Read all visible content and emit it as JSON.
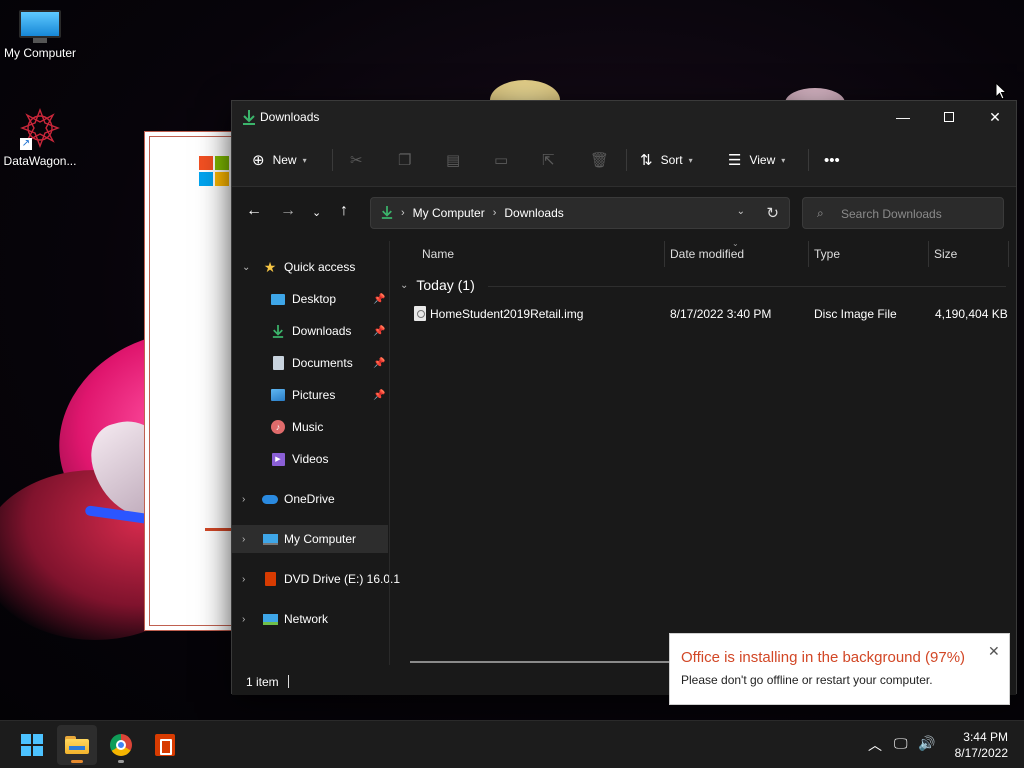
{
  "desktop": {
    "icons": [
      {
        "label": "My Computer",
        "icon": "monitor-icon"
      },
      {
        "label": "DataWagon...",
        "icon": "datawagon-logo-icon"
      }
    ]
  },
  "window": {
    "title": "Downloads",
    "icon": "download-arrow-icon"
  },
  "toolbar": {
    "new_label": "New",
    "sort_label": "Sort",
    "view_label": "View",
    "disabled_actions": [
      "cut",
      "copy",
      "paste",
      "rename",
      "share",
      "delete"
    ]
  },
  "address": {
    "breadcrumbs": [
      "My Computer",
      "Downloads"
    ]
  },
  "search": {
    "placeholder": "Search Downloads"
  },
  "nav": {
    "quick_access": "Quick access",
    "items": [
      {
        "label": "Desktop",
        "icon": "desktop-icon",
        "pinned": true
      },
      {
        "label": "Downloads",
        "icon": "download-icon",
        "pinned": true
      },
      {
        "label": "Documents",
        "icon": "document-icon",
        "pinned": true
      },
      {
        "label": "Pictures",
        "icon": "pictures-icon",
        "pinned": true
      },
      {
        "label": "Music",
        "icon": "music-icon",
        "pinned": false
      },
      {
        "label": "Videos",
        "icon": "videos-icon",
        "pinned": false
      }
    ],
    "onedrive": "OneDrive",
    "my_computer": "My Computer",
    "dvd": "DVD Drive (E:) 16.0.1",
    "network": "Network"
  },
  "columns": {
    "name": "Name",
    "date": "Date modified",
    "type": "Type",
    "size": "Size"
  },
  "group": {
    "label": "Today (1)"
  },
  "files": [
    {
      "name": "HomeStudent2019Retail.img",
      "date": "8/17/2022 3:40 PM",
      "type": "Disc Image File",
      "size": "4,190,404 KB"
    }
  ],
  "status": {
    "count": "1 item"
  },
  "notification": {
    "title": "Office is installing in the background (97%)",
    "message": "Please don't go offline or restart your computer.",
    "color": "#d24726"
  },
  "taskbar": {
    "time": "3:44 PM",
    "date": "8/17/2022"
  },
  "colors": {
    "accent": "#4cc2ff",
    "download_green": "#3bb56b",
    "office_red": "#d83b01"
  }
}
